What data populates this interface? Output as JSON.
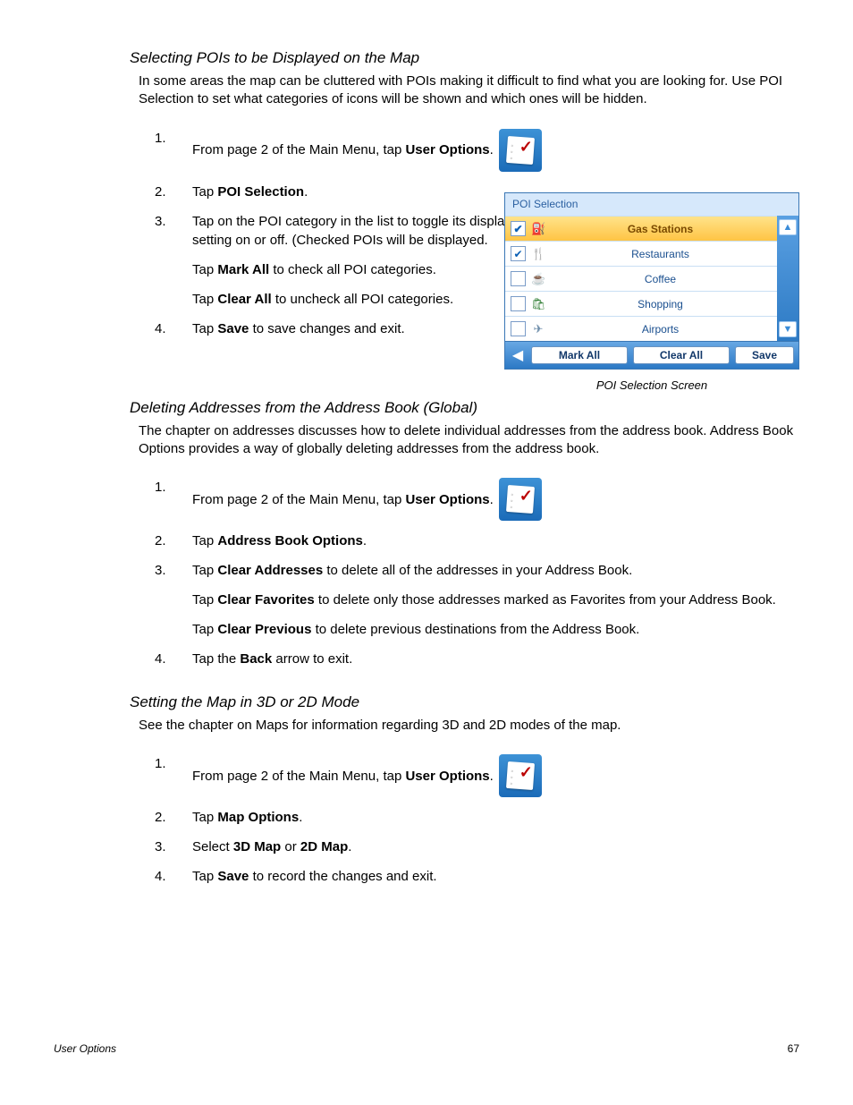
{
  "section1": {
    "heading": "Selecting POIs to be Displayed on the Map",
    "intro": "In some areas the map can be cluttered with POIs making it difficult to find what you are looking for.  Use POI Selection to set what categories of icons will be shown and which ones will be hidden.",
    "steps": {
      "s1_pre": "From page 2 of the Main Menu, tap ",
      "s1_bold": "User Options",
      "s1_post": ".",
      "s2_pre": "Tap ",
      "s2_bold": "POI Selection",
      "s2_post": ".",
      "s3_body": "Tap on the POI category in the list to toggle its display setting on or off.  (Checked POIs will be displayed.",
      "s3_b_pre": "Tap ",
      "s3_b_bold": "Mark All",
      "s3_b_post": " to check all POI categories.",
      "s3_c_pre": "Tap ",
      "s3_c_bold": "Clear All",
      "s3_c_post": " to uncheck all POI categories.",
      "s4_pre": "Tap ",
      "s4_bold": "Save",
      "s4_post": " to save changes and exit."
    }
  },
  "poi_fig": {
    "title": "POI Selection",
    "rows": [
      {
        "checked": true,
        "icon": "⛽",
        "icon_color": "#c0392b",
        "label": "Gas Stations",
        "selected": true
      },
      {
        "checked": true,
        "icon": "🍴",
        "icon_color": "#333",
        "label": "Restaurants",
        "selected": false
      },
      {
        "checked": false,
        "icon": "☕",
        "icon_color": "#8a6d3b",
        "label": "Coffee",
        "selected": false
      },
      {
        "checked": false,
        "icon": "🛍",
        "icon_color": "#2e7d32",
        "label": "Shopping",
        "selected": false
      },
      {
        "checked": false,
        "icon": "✈",
        "icon_color": "#6a8aa8",
        "label": "Airports",
        "selected": false
      }
    ],
    "buttons": {
      "mark_all": "Mark All",
      "clear_all": "Clear All",
      "save": "Save"
    },
    "caption": "POI Selection Screen"
  },
  "section2": {
    "heading": "Deleting Addresses from the Address Book (Global)",
    "intro": "The chapter on addresses discusses how to delete individual addresses from the address book.  Address Book Options provides a way of globally deleting addresses from the address book.",
    "steps": {
      "s1_pre": "From page 2 of the Main Menu, tap ",
      "s1_bold": "User Options",
      "s1_post": ".",
      "s2_pre": "Tap ",
      "s2_bold": "Address Book Options",
      "s2_post": ".",
      "s3_a_pre": "Tap ",
      "s3_a_bold": "Clear Addresses",
      "s3_a_post": " to delete all of the addresses in your Address Book.",
      "s3_b_pre": "Tap ",
      "s3_b_bold": "Clear Favorites",
      "s3_b_post": " to delete only those addresses marked as Favorites from your Address Book.",
      "s3_c_pre": "Tap ",
      "s3_c_bold": "Clear Previous",
      "s3_c_post": " to delete previous destinations from the Address Book.",
      "s4_pre": "Tap the ",
      "s4_bold": "Back",
      "s4_post": " arrow to exit."
    }
  },
  "section3": {
    "heading": "Setting the Map in 3D or 2D Mode",
    "intro": "See the chapter on Maps for information regarding 3D and 2D modes of the map.",
    "steps": {
      "s1_pre": "From page 2 of the Main Menu, tap ",
      "s1_bold": "User Options",
      "s1_post": ".",
      "s2_pre": "Tap ",
      "s2_bold": "Map Options",
      "s2_post": ".",
      "s3_pre": "Select ",
      "s3_bold1": "3D Map",
      "s3_mid": " or ",
      "s3_bold2": "2D Map",
      "s3_post": ".",
      "s4_pre": "Tap ",
      "s4_bold": "Save",
      "s4_post": " to record the changes and exit."
    }
  },
  "footer": {
    "left": "User Options",
    "right": "67"
  }
}
